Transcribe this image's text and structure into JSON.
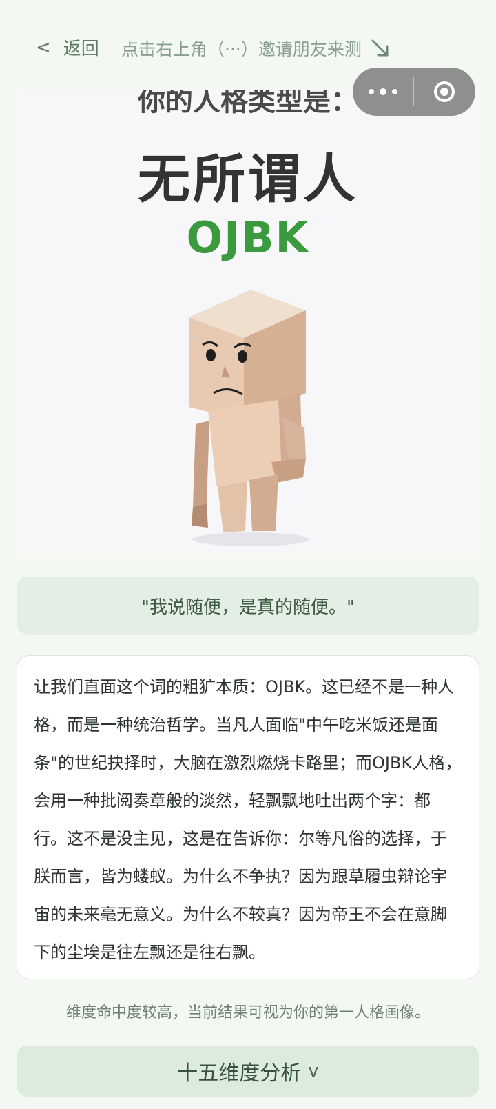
{
  "nav": {
    "back_chevron": "<",
    "back_label": "返回",
    "invite_text": "点击右上角（···）邀请朋友来测",
    "invite_arrow_icon": "arrow-down-right-icon"
  },
  "capsule": {
    "more_icon": "more-dots-icon",
    "close_icon": "close-target-icon"
  },
  "result_image": {
    "heading": "你的人格类型是：",
    "type_name": "无所谓人",
    "type_code": "OJBK",
    "type_code_color": "#3b9a3d"
  },
  "quote": "\"我说随便，是真的随便。\"",
  "description": "让我们直面这个词的粗犷本质：OJBK。这已经不是一种人格，而是一种统治哲学。当凡人面临\"中午吃米饭还是面条\"的世纪抉择时，大脑在激烈燃烧卡路里；而OJBK人格，会用一种批阅奏章般的淡然，轻飘飘地吐出两个字：都行。这不是没主见，这是在告诉你：尔等凡俗的选择，于朕而言，皆为蝼蚁。为什么不争执？因为跟草履虫辩论宇宙的未来毫无意义。为什么不较真？因为帝王不会在意脚下的尘埃是往左飘还是往右飘。",
  "hint": "维度命中度较高，当前结果可视为你的第一人格画像。",
  "dimension_button": {
    "label": "十五维度分析",
    "chevron": "v"
  },
  "colors": {
    "background": "#f3f8f3",
    "quote_bg": "#e3efe4",
    "button_bg": "#dcebdd"
  }
}
